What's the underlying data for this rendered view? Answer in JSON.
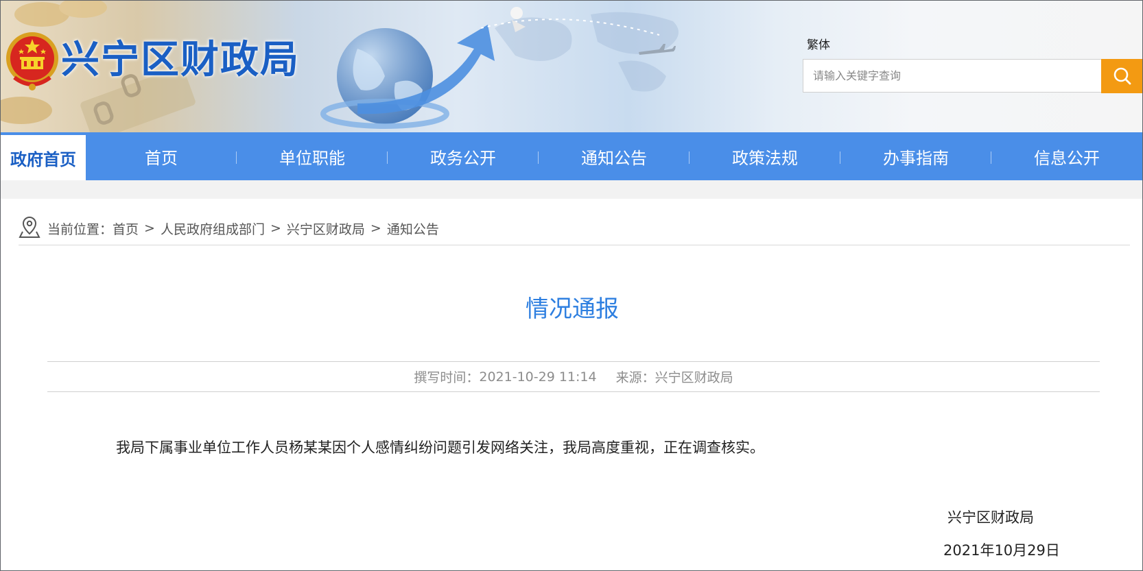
{
  "header": {
    "site_title": "兴宁区财政局",
    "lang_toggle": "繁体",
    "search": {
      "placeholder": "请输入关键字查询",
      "value": ""
    }
  },
  "nav": {
    "home_label": "政府首页",
    "items": [
      {
        "label": "首页"
      },
      {
        "label": "单位职能"
      },
      {
        "label": "政务公开"
      },
      {
        "label": "通知公告"
      },
      {
        "label": "政策法规"
      },
      {
        "label": "办事指南"
      },
      {
        "label": "信息公开"
      }
    ]
  },
  "breadcrumb": {
    "prefix": "当前位置：",
    "separator": ">",
    "items": [
      "首页",
      "人民政府组成部门",
      "兴宁区财政局",
      "通知公告"
    ]
  },
  "article": {
    "title": "情况通报",
    "meta": {
      "time_label": "撰写时间：",
      "time_value": "2021-10-29 11:14",
      "source_label": "来源：",
      "source_value": "兴宁区财政局"
    },
    "body": "我局下属事业单位工作人员杨某某因个人感情纠纷问题引发网络关注，我局高度重视，正在调查核实。",
    "signature_org": "兴宁区财政局",
    "signature_date": "2021年10月29日"
  },
  "colors": {
    "brand_blue": "#4a8ee8",
    "title_blue": "#2e7fe0",
    "search_orange": "#f39a12"
  },
  "icons": {
    "emblem": "national-emblem",
    "search": "magnifier-icon",
    "location": "location-pin-icon"
  }
}
